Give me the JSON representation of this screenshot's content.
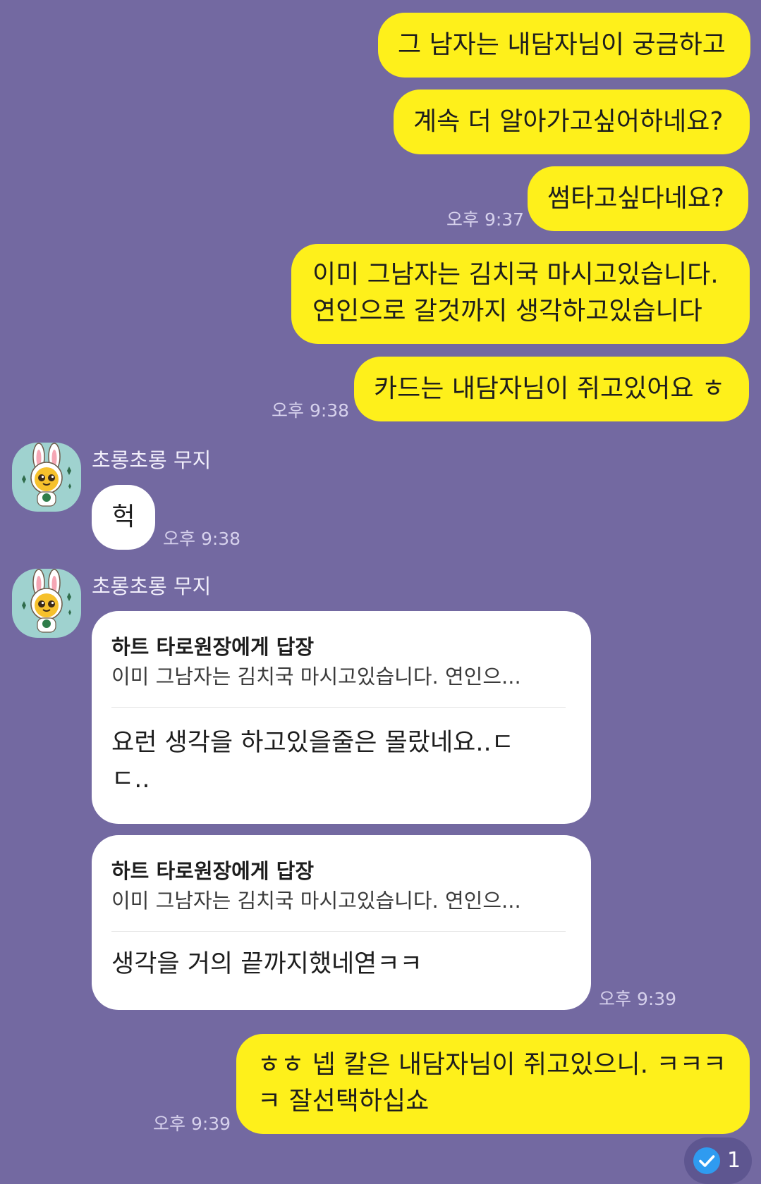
{
  "chat": {
    "sender_name": "초롱초롱 무지",
    "messages": [
      {
        "from": "me",
        "text": "그 남자는 내담자님이 궁금하고"
      },
      {
        "from": "me",
        "text": "계속 더 알아가고싶어하네요?"
      },
      {
        "from": "me",
        "text": "썸타고싶다네요?",
        "time": "오후 9:37"
      },
      {
        "from": "me",
        "lines": [
          "이미 그남자는 김치국 마시고있습니다.",
          "연인으로 갈것까지 생각하고있습니다"
        ]
      },
      {
        "from": "me",
        "text": "카드는 내담자님이 쥐고있어요 ㅎ",
        "time": "오후 9:38"
      },
      {
        "from": "them",
        "text": "헉",
        "time": "오후 9:38"
      },
      {
        "from": "them",
        "reply_to": "하트 타로원장에게 답장",
        "quote": "이미 그남자는 김치국 마시고있습니다. 연인으...",
        "lines": [
          "요런 생각을 하고있을줄은 몰랐네요..ㄷ",
          "ㄷ.."
        ]
      },
      {
        "from": "them",
        "reply_to": "하트 타로원장에게 답장",
        "quote": "이미 그남자는 김치국 마시고있습니다. 연인으...",
        "text": "생각을 거의 끝까지했네엳ㅋㅋ",
        "time": "오후 9:39"
      },
      {
        "from": "me",
        "lines": [
          "ㅎㅎ 넵 칼은 내담자님이 쥐고있으니. ㅋㅋㅋ",
          "ㅋ 잘선택하십쇼"
        ],
        "time": "오후 9:39"
      }
    ]
  },
  "read_badge": {
    "icon": "check-circle-icon",
    "count": "1"
  },
  "colors": {
    "background": "#7369a1",
    "my_bubble": "#fef01b",
    "their_bubble": "#ffffff",
    "check": "#2f9bf0"
  }
}
